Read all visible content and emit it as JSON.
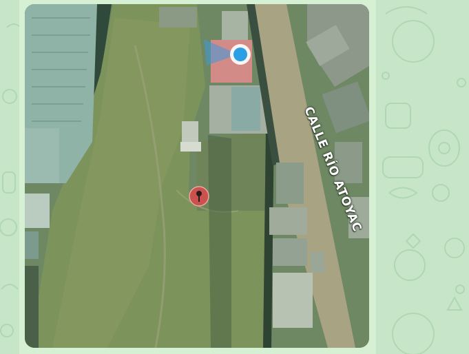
{
  "map": {
    "street_label": "CALLE RÍO ATOYAC",
    "view": "satellite",
    "markers": [
      {
        "type": "current-location",
        "icon": "location-dot-icon",
        "color": "#2a9fe6"
      },
      {
        "type": "dropped-pin",
        "icon": "map-pin-icon",
        "color": "#c9524e"
      }
    ]
  }
}
